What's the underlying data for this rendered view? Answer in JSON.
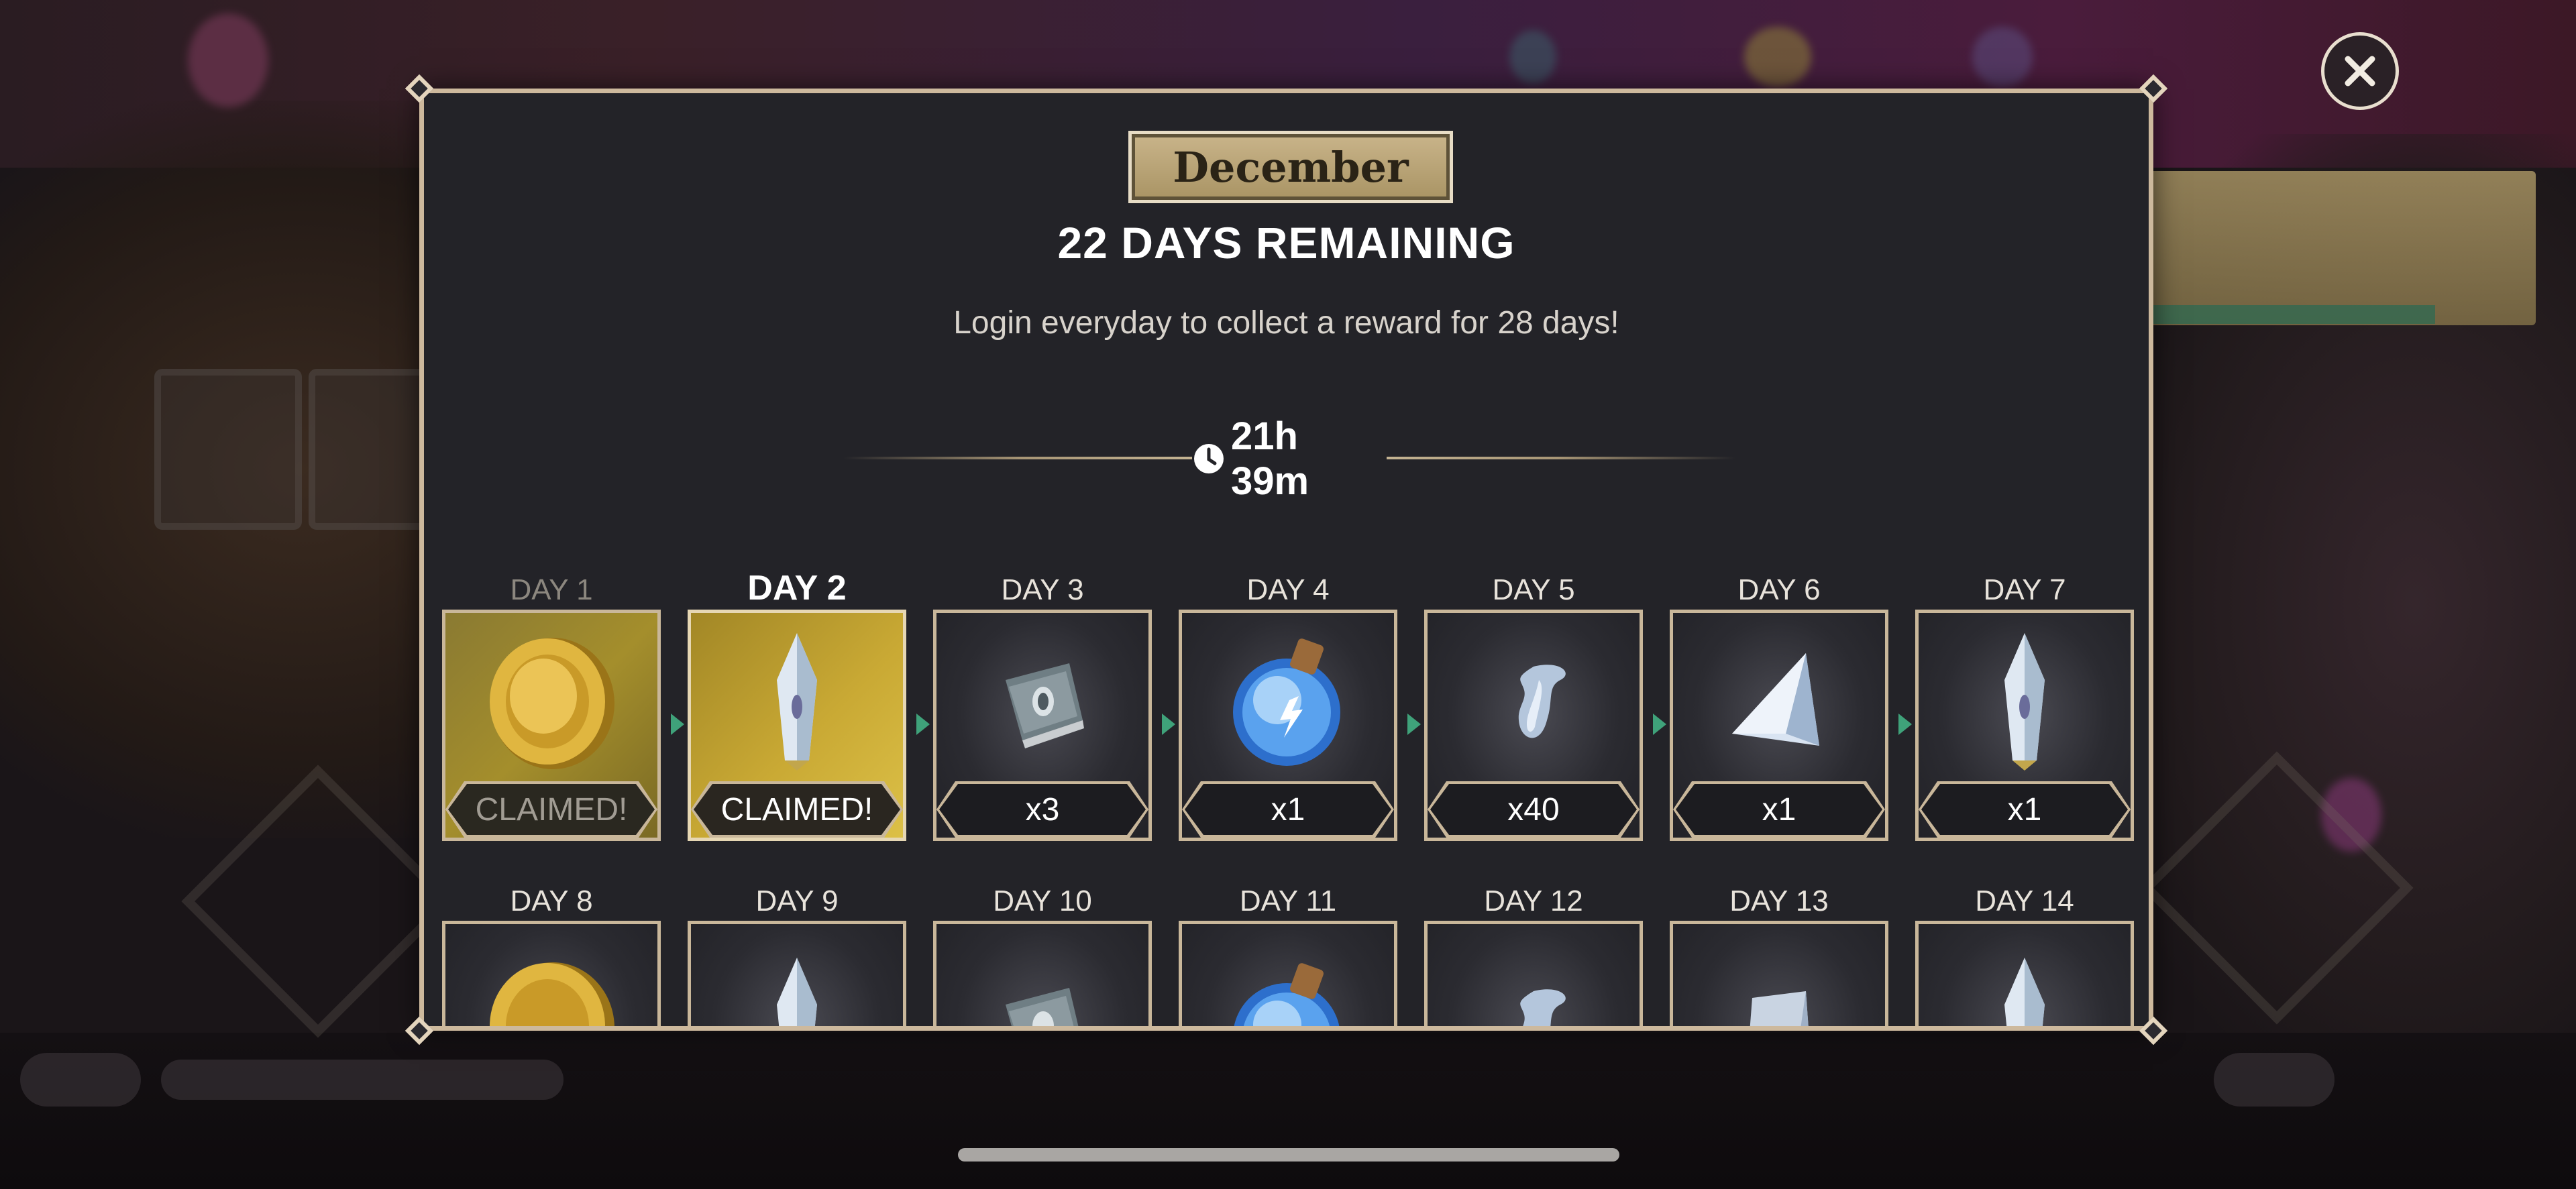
{
  "modal": {
    "month": "December",
    "days_remaining": "22 DAYS REMAINING",
    "subtitle": "Login everyday to collect a reward for 28 days!",
    "timer": "21h 39m"
  },
  "rewards_row1": [
    {
      "day": "DAY 1",
      "icon": "gold-coin-icon",
      "quantity": "CLAIMED!",
      "state": "claimed"
    },
    {
      "day": "DAY 2",
      "icon": "crystal-shard-icon",
      "quantity": "CLAIMED!",
      "state": "claimed-today"
    },
    {
      "day": "DAY 3",
      "icon": "spellbook-icon",
      "quantity": "x3",
      "state": "locked"
    },
    {
      "day": "DAY 4",
      "icon": "potion-flask-icon",
      "quantity": "x1",
      "state": "locked"
    },
    {
      "day": "DAY 5",
      "icon": "wisp-essence-icon",
      "quantity": "x40",
      "state": "locked"
    },
    {
      "day": "DAY 6",
      "icon": "prism-pyramid-icon",
      "quantity": "x1",
      "state": "locked"
    },
    {
      "day": "DAY 7",
      "icon": "crystal-shard-icon",
      "quantity": "x1",
      "state": "locked"
    }
  ],
  "rewards_row2": [
    {
      "day": "DAY 8",
      "icon": "gold-coin-icon"
    },
    {
      "day": "DAY 9",
      "icon": "crystal-shard-icon"
    },
    {
      "day": "DAY 10",
      "icon": "spellbook-icon"
    },
    {
      "day": "DAY 11",
      "icon": "potion-flask-icon"
    },
    {
      "day": "DAY 12",
      "icon": "wisp-essence-icon"
    },
    {
      "day": "DAY 13",
      "icon": "crystal-block-icon"
    },
    {
      "day": "DAY 14",
      "icon": "crystal-shard-icon"
    }
  ],
  "colors": {
    "modal_bg": "#232328",
    "frame_gold": "#cdb99d",
    "claimed_gold": "#c9a934",
    "arrow_green": "#3fa27a"
  }
}
